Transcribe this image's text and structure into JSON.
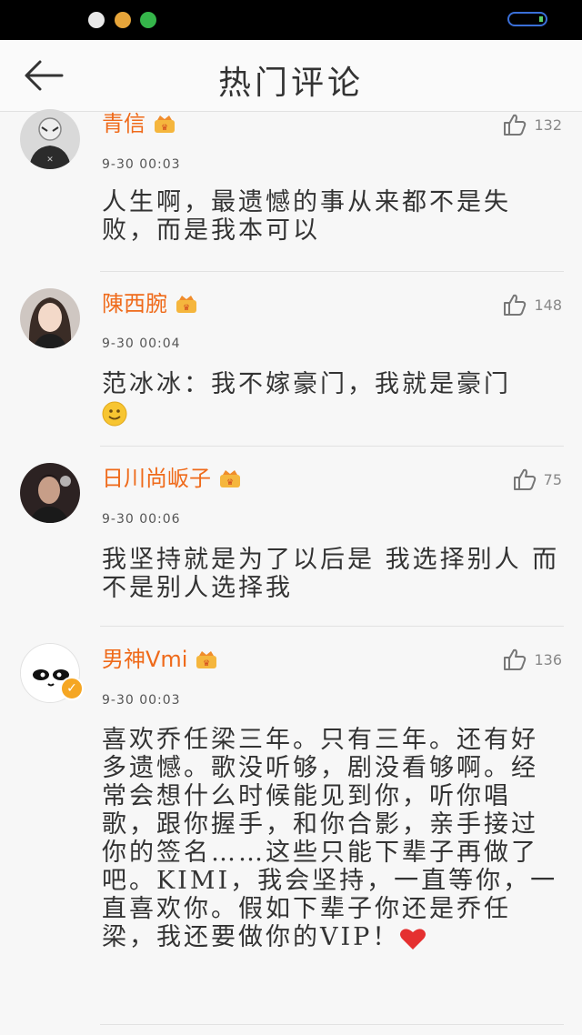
{
  "header": {
    "title": "热门评论"
  },
  "comments": [
    {
      "username": "青信",
      "timestamp": "9-30 00:03",
      "likes": "132",
      "text": "人生啊，最遗憾的事从来都不是失败，而是我本可以",
      "emoji": ""
    },
    {
      "username": "陳西腕",
      "timestamp": "9-30 00:04",
      "likes": "148",
      "text": "范冰冰：我不嫁豪门，我就是豪门",
      "emoji": "smile"
    },
    {
      "username": "日川尚岅子",
      "timestamp": "9-30 00:06",
      "likes": "75",
      "text": "我坚持就是为了以后是 我选择别人 而不是别人选择我",
      "emoji": ""
    },
    {
      "username": "男神Vmi",
      "timestamp": "9-30 00:03",
      "likes": "136",
      "text": "喜欢乔任梁三年。只有三年。还有好多遗憾。歌没听够，剧没看够啊。经常会想什么时候能见到你，听你唱歌，跟你握手，和你合影，亲手接过你的签名……这些只能下辈子再做了吧。KIMI，我会坚持，一直等你，一直喜欢你。假如下辈子你还是乔任梁，我还要做你的VIP！",
      "emoji": "heart"
    }
  ],
  "icons": {
    "back": "arrow-left-icon",
    "like": "thumbs-up-icon",
    "badge": "vip-crown-icon",
    "verified": "verified-icon"
  },
  "colors": {
    "username": "#ef6a1a",
    "badge": "#f5a623"
  }
}
